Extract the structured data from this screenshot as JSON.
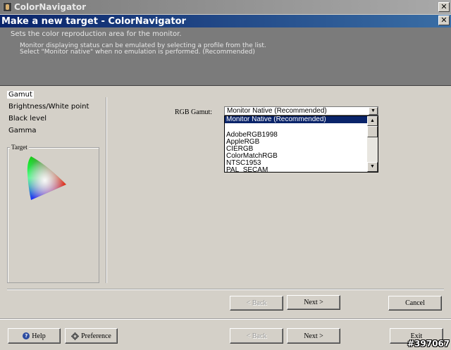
{
  "window": {
    "outer_title": "ColorNavigator",
    "inner_title": "Make a new target - ColorNavigator",
    "close_glyph": "✕"
  },
  "header": {
    "heading": "Sets the color reproduction area for the monitor.",
    "line1": "Monitor displaying status can be emulated by selecting a profile from the list.",
    "line2": "Select \"Monitor native\" when no emulation is performed. (Recommended)"
  },
  "nav": {
    "items": [
      {
        "label": "Gamut"
      },
      {
        "label": "Brightness/White point"
      },
      {
        "label": "Black level"
      },
      {
        "label": "Gamma"
      }
    ],
    "target_group_label": "Target"
  },
  "main": {
    "rgb_gamut_label": "RGB Gamut:",
    "rgb_gamut_value": "Monitor Native (Recommended)",
    "options": [
      "Monitor Native (Recommended)",
      "",
      "AdobeRGB1998",
      "AppleRGB",
      "CIERGB",
      "ColorMatchRGB",
      "NTSC1953",
      "PAL_SECAM"
    ]
  },
  "buttons": {
    "back": "< Back",
    "next": "Next >",
    "cancel": "Cancel",
    "help": "Help",
    "preference": "Preference",
    "exit": "Exit"
  },
  "watermark": "#397067",
  "colors": {
    "inner_title_start": "#0a246a",
    "inner_title_end": "#3a6ea5",
    "header_bg": "#7b7b7b",
    "dialog_bg": "#d4d0c8",
    "selection": "#0a246a"
  }
}
